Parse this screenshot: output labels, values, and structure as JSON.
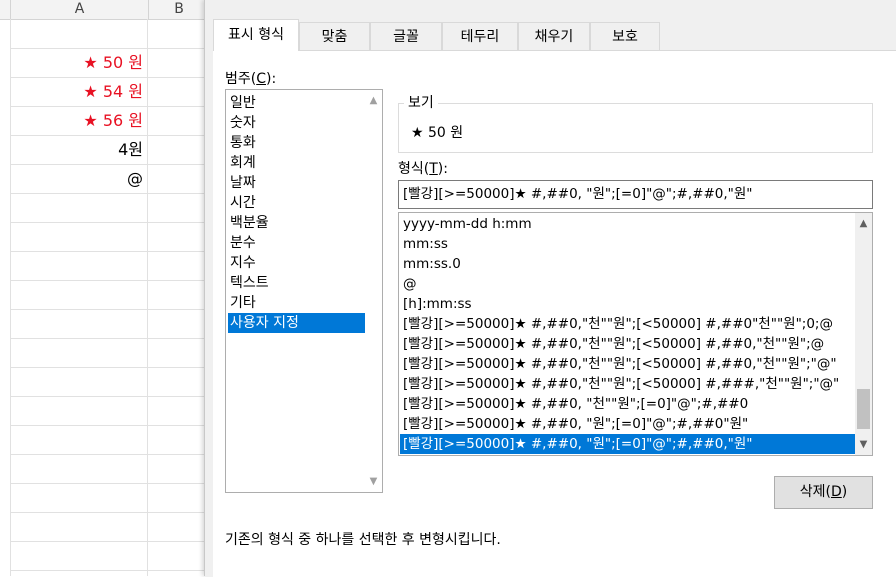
{
  "sheet": {
    "columns": [
      "A",
      "B"
    ],
    "cells": [
      {
        "text": "★ 50 원",
        "color": "#e81123"
      },
      {
        "text": "★ 54 원",
        "color": "#e81123"
      },
      {
        "text": "★ 56 원",
        "color": "#e81123"
      },
      {
        "text": "4원",
        "color": "#000000"
      },
      {
        "text": "@",
        "color": "#000000"
      }
    ]
  },
  "dialog": {
    "tabs": [
      "표시 형식",
      "맞춤",
      "글꼴",
      "테두리",
      "채우기",
      "보호"
    ],
    "active_tab": "표시 형식",
    "category_label": "범주(",
    "category_key": "C",
    "category_label_end": "):",
    "categories": [
      "일반",
      "숫자",
      "통화",
      "회계",
      "날짜",
      "시간",
      "백분율",
      "분수",
      "지수",
      "텍스트",
      "기타",
      "사용자 지정"
    ],
    "selected_category": "사용자 지정",
    "preview_label": "보기",
    "preview_value": "★ 50 원",
    "format_label": "형식(",
    "format_key": "T",
    "format_label_end": "):",
    "format_input_value": "[빨강][>=50000]★ #,##0, \"원\";[=0]\"@\";#,##0,\"원\"",
    "format_list": [
      "yyyy-mm-dd h:mm",
      "mm:ss",
      "mm:ss.0",
      "@",
      "[h]:mm:ss",
      "[빨강][>=50000]★ #,##0,\"천\"\"원\";[<50000] #,##0\"천\"\"원\";0;@",
      "[빨강][>=50000]★ #,##0,\"천\"\"원\";[<50000] #,##0,\"천\"\"원\";@",
      "[빨강][>=50000]★ #,##0,\"천\"\"원\";[<50000] #,##0,\"천\"\"원\";\"@\"",
      "[빨강][>=50000]★ #,##0,\"천\"\"원\";[<50000] #,###,\"천\"\"원\";\"@\"",
      "[빨강][>=50000]★ #,##0, \"천\"\"원\";[=0]\"@\";#,##0",
      "[빨강][>=50000]★ #,##0, \"원\";[=0]\"@\";#,##0\"원\"",
      "[빨강][>=50000]★ #,##0, \"원\";[=0]\"@\";#,##0,\"원\""
    ],
    "selected_format_index": 11,
    "delete_label": "삭제(",
    "delete_key": "D",
    "delete_label_end": ")",
    "hint": "기존의 형식 중 하나를 선택한 후 변형시킵니다.",
    "accent_color": "#0078d7"
  }
}
